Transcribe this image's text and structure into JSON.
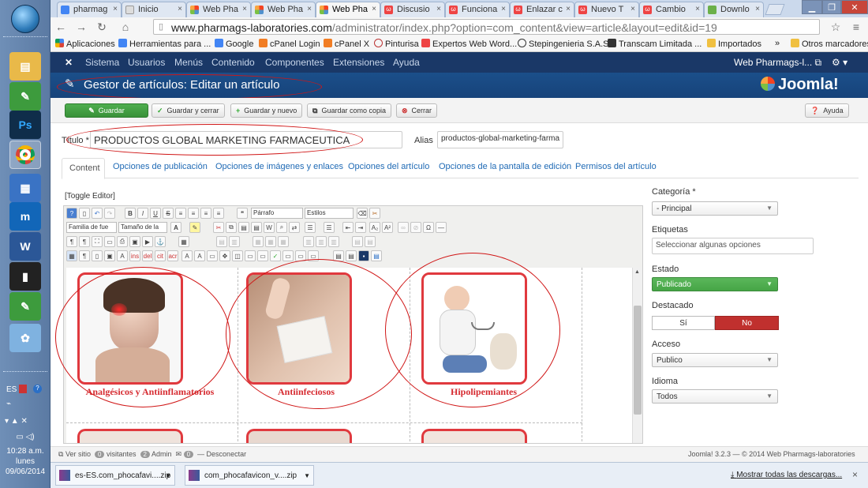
{
  "taskbar": {
    "time": "10:28 a.m.",
    "day": "lunes",
    "date": "09/06/2014",
    "lang": "ES"
  },
  "browser": {
    "tabs": [
      {
        "label": "pharmag",
        "icon": "google-icon"
      },
      {
        "label": "Inicio",
        "icon": "document-icon"
      },
      {
        "label": "Web Pha",
        "icon": "joomla-icon"
      },
      {
        "label": "Web Pha",
        "icon": "joomla-icon"
      },
      {
        "label": "Web Pha",
        "icon": "joomla-icon"
      },
      {
        "label": "Discusio",
        "icon": "wordpress-icon"
      },
      {
        "label": "Funciona",
        "icon": "wordpress-icon"
      },
      {
        "label": "Enlazar c",
        "icon": "wordpress-icon"
      },
      {
        "label": "Nuevo T",
        "icon": "wordpress-icon"
      },
      {
        "label": "Cambio",
        "icon": "wordpress-icon"
      },
      {
        "label": "Downlo",
        "icon": "download-icon"
      }
    ],
    "url_host": "www.pharmags-laboratories.com",
    "url_path": "/administrator/index.php?option=com_content&view=article&layout=edit&id=19",
    "bookmarks": [
      "Aplicaciones",
      "Herramientas para ...",
      "Google",
      "cPanel Login",
      "cPanel X",
      "Pinturisa",
      "Expertos Web Word...",
      "Stepingenieria S.A.S.",
      "Transcam Limitada ...",
      "Importados"
    ],
    "bookmarks_more": "»",
    "other_bookmarks": "Otros marcadores"
  },
  "joomla": {
    "menu": [
      "Sistema",
      "Usuarios",
      "Menús",
      "Contenido",
      "Componentes",
      "Extensiones",
      "Ayuda"
    ],
    "site_name": "Web Pharmags-l...",
    "page_title": "Gestor de artículos: Editar un artículo",
    "logo_text": "Joomla!",
    "toolbar": {
      "save": "Guardar",
      "save_close": "Guardar y cerrar",
      "save_new": "Guardar y nuevo",
      "save_copy": "Guardar como copia",
      "close": "Cerrar",
      "help": "Ayuda"
    },
    "form": {
      "title_label": "Título *",
      "title_value": "PRODUCTOS GLOBAL MARKETING FARMACEUTICA",
      "alias_label": "Alias",
      "alias_value": "productos-global-marketing-farma"
    },
    "tabs": [
      "Content",
      "Opciones de publicación",
      "Opciones de imágenes y enlaces",
      "Opciones del artículo",
      "Opciones de la pantalla de edición",
      "Permisos del artículo"
    ],
    "toggle_editor": "[Toggle Editor]",
    "editor": {
      "format_select": "Párrafo",
      "styles_select": "Estilos",
      "font_family": "Familia de fue",
      "font_size": "Tamaño de la"
    },
    "products": [
      {
        "caption": "Analgésicos y Antiinflamatorios"
      },
      {
        "caption": "Antiinfeciosos"
      },
      {
        "caption": "Hipolipemiantes"
      }
    ],
    "sidebar": {
      "category_label": "Categoría *",
      "category_value": "- Principal",
      "tags_label": "Etiquetas",
      "tags_placeholder": "Seleccionar algunas opciones",
      "state_label": "Estado",
      "state_value": "Publicado",
      "featured_label": "Destacado",
      "featured_yes": "Sí",
      "featured_no": "No",
      "access_label": "Acceso",
      "access_value": "Publico",
      "language_label": "Idioma",
      "language_value": "Todos"
    },
    "status": {
      "view_site": "Ver sitio",
      "visitors_count": "0",
      "visitors_label": "visitantes",
      "admin_count": "2",
      "admin_label": "Admin",
      "messages_count": "0",
      "logout": "Desconectar",
      "version": "Joomla! 3.2.3 — © 2014 Web Pharmags-laboratories"
    }
  },
  "downloads": {
    "items": [
      "es-ES.com_phocafavi....zip",
      "com_phocafavicon_v....zip"
    ],
    "show_all": "Mostrar todas las descargas..."
  },
  "colors": {
    "joomla_nav": "#1a3867",
    "joomla_header": "#1b4f8a",
    "save_green": "#46a546",
    "no_red": "#c0302e",
    "caption_red": "#d62b31"
  }
}
